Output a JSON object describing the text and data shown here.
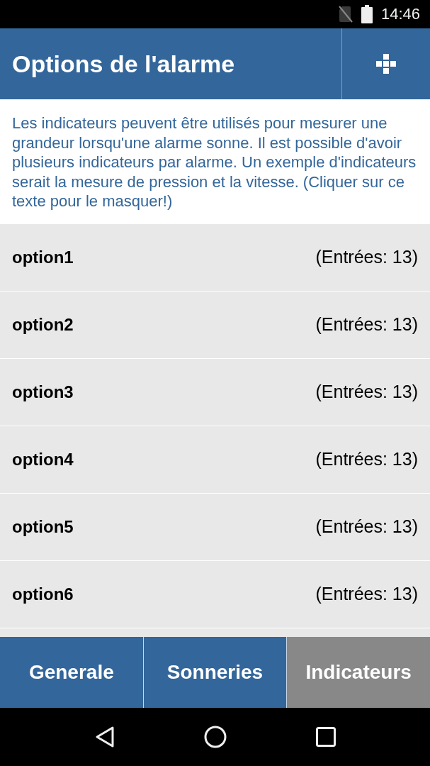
{
  "status_bar": {
    "time": "14:46"
  },
  "header": {
    "title": "Options de l'alarme"
  },
  "info_text": "Les indicateurs peuvent être utilisés pour mesurer une grandeur lorsqu'une alarme sonne. Il est possible d'avoir plusieurs indicateurs par alarme. Un exemple d'indicateurs serait la mesure de pression et la vitesse. (Cliquer sur ce texte pour le masquer!)",
  "options": [
    {
      "name": "option1",
      "entries": "(Entrées: 13)"
    },
    {
      "name": "option2",
      "entries": "(Entrées: 13)"
    },
    {
      "name": "option3",
      "entries": "(Entrées: 13)"
    },
    {
      "name": "option4",
      "entries": "(Entrées: 13)"
    },
    {
      "name": "option5",
      "entries": "(Entrées: 13)"
    },
    {
      "name": "option6",
      "entries": "(Entrées: 13)"
    }
  ],
  "tabs": [
    {
      "label": "Generale",
      "selected": false
    },
    {
      "label": "Sonneries",
      "selected": false
    },
    {
      "label": "Indicateurs",
      "selected": true
    }
  ]
}
